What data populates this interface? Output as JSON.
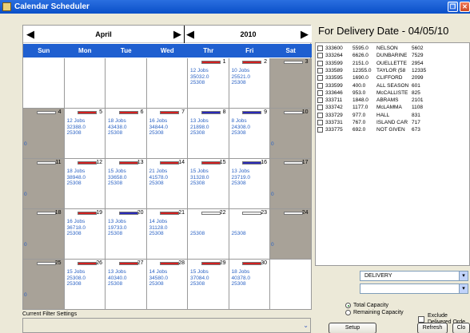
{
  "window": {
    "title": "Calendar Scheduler"
  },
  "calendar": {
    "month": "April",
    "year": "2010",
    "days": [
      "Sun",
      "Mon",
      "Tue",
      "Wed",
      "Thr",
      "Fri",
      "Sat"
    ],
    "weeks": [
      [
        {
          "num": "",
          "gray": false
        },
        {
          "num": "",
          "gray": false
        },
        {
          "num": "",
          "gray": false
        },
        {
          "num": "",
          "gray": false
        },
        {
          "num": "1",
          "gray": false,
          "bar": "red",
          "lines": [
            "12 Jobs",
            "35032.0",
            "25308"
          ]
        },
        {
          "num": "2",
          "gray": false,
          "bar": "red",
          "lines": [
            "10 Jobs",
            "25521.0",
            "25308"
          ]
        },
        {
          "num": "3",
          "gray": true,
          "bar": "white"
        }
      ],
      [
        {
          "num": "4",
          "gray": true,
          "bar": "white",
          "side": "0"
        },
        {
          "num": "5",
          "gray": false,
          "bar": "red",
          "lines": [
            "12 Jobs",
            "32388.0",
            "25308"
          ]
        },
        {
          "num": "6",
          "gray": false,
          "bar": "red",
          "lines": [
            "18 Jobs",
            "43438.0",
            "25308"
          ]
        },
        {
          "num": "7",
          "gray": false,
          "bar": "red",
          "lines": [
            "16 Jobs",
            "34844.0",
            "25308"
          ]
        },
        {
          "num": "8",
          "gray": false,
          "bar": "blue",
          "lines": [
            "13 Jobs",
            "21898.0",
            "25308"
          ]
        },
        {
          "num": "9",
          "gray": false,
          "bar": "blue",
          "lines": [
            "8 Jobs",
            "24308.0",
            "25308"
          ]
        },
        {
          "num": "10",
          "gray": true,
          "bar": "white",
          "side": "0"
        }
      ],
      [
        {
          "num": "11",
          "gray": true,
          "bar": "white",
          "side": "0"
        },
        {
          "num": "12",
          "gray": false,
          "bar": "red",
          "lines": [
            "18 Jobs",
            "38948.0",
            "25308"
          ]
        },
        {
          "num": "13",
          "gray": false,
          "bar": "red",
          "lines": [
            "15 Jobs",
            "33658.0",
            "25308"
          ]
        },
        {
          "num": "14",
          "gray": false,
          "bar": "red",
          "lines": [
            "21 Jobs",
            "41578.0",
            "25308"
          ]
        },
        {
          "num": "15",
          "gray": false,
          "bar": "red",
          "lines": [
            "15 Jobs",
            "31328.0",
            "25308"
          ]
        },
        {
          "num": "16",
          "gray": false,
          "bar": "blue",
          "lines": [
            "13 Jobs",
            "23719.0",
            "25308"
          ]
        },
        {
          "num": "17",
          "gray": true,
          "bar": "white",
          "side": "0"
        }
      ],
      [
        {
          "num": "18",
          "gray": true,
          "bar": "white",
          "side": "0"
        },
        {
          "num": "19",
          "gray": false,
          "bar": "red",
          "lines": [
            "16 Jobs",
            "36718.0",
            "25308"
          ]
        },
        {
          "num": "20",
          "gray": false,
          "bar": "blue",
          "lines": [
            "13 Jobs",
            "19733.0",
            "25308"
          ]
        },
        {
          "num": "21",
          "gray": false,
          "bar": "red",
          "lines": [
            "14 Jobs",
            "31128.0",
            "25308"
          ]
        },
        {
          "num": "22",
          "gray": false,
          "bar": "white",
          "lines": [
            "",
            "",
            "25308"
          ]
        },
        {
          "num": "23",
          "gray": false,
          "bar": "white",
          "lines": [
            "",
            "",
            "25308"
          ]
        },
        {
          "num": "24",
          "gray": true,
          "bar": "white",
          "side": "0"
        }
      ],
      [
        {
          "num": "25",
          "gray": true,
          "bar": "white",
          "side": "0"
        },
        {
          "num": "26",
          "gray": false,
          "bar": "red",
          "lines": [
            "15 Jobs",
            "25308.0",
            "25308"
          ]
        },
        {
          "num": "27",
          "gray": false,
          "bar": "red",
          "lines": [
            "13 Jobs",
            "40340.0",
            "25308"
          ]
        },
        {
          "num": "28",
          "gray": false,
          "bar": "red",
          "lines": [
            "14 Jobs",
            "34580.0",
            "25308"
          ]
        },
        {
          "num": "29",
          "gray": false,
          "bar": "red",
          "lines": [
            "15 Jobs",
            "37084.0",
            "25308"
          ]
        },
        {
          "num": "30",
          "gray": false,
          "bar": "red",
          "lines": [
            "18 Jobs",
            "40378.0",
            "25308"
          ]
        },
        {
          "num": "",
          "gray": false
        }
      ]
    ]
  },
  "filter": {
    "label": "Current Filter Settings"
  },
  "delivery": {
    "title": "For Delivery Date - 04/05/10",
    "rows": [
      [
        "333600",
        "5595.0",
        "NELSON",
        "5602"
      ],
      [
        "333264",
        "6626.0",
        "DUNBARINE",
        "7529"
      ],
      [
        "333599",
        "2151.0",
        "OUELLETTE",
        "2954"
      ],
      [
        "333589",
        "12355.0",
        "TAYLOR (58",
        "12335"
      ],
      [
        "333595",
        "1690.0",
        "CLIFFORD",
        "2099"
      ],
      [
        "333599",
        "400.0",
        "ALL SEASON",
        "601"
      ],
      [
        "333646",
        "953.0",
        "McCALLISTE",
        "825"
      ],
      [
        "333711",
        "1848.0",
        "ABRAMS",
        "2101"
      ],
      [
        "333742",
        "1177.0",
        "McLAMMA",
        "1108"
      ],
      [
        "333729",
        "977.0",
        "HALL",
        "831"
      ],
      [
        "333731",
        "767.0",
        "ISLAND CAR",
        "717"
      ],
      [
        "333775",
        "692.0",
        "NOT GIVEN",
        "673"
      ]
    ],
    "select_value": "DELIVERY",
    "select2_value": ""
  },
  "capacity": {
    "total_label": "Total Capacity",
    "remaining_label": "Remaining Capacity",
    "exclude_label_1": "Exclude",
    "exclude_label_2": "Delivered Orde"
  },
  "buttons": {
    "setup": "Setup Capacities...",
    "refresh": "Refresh",
    "close": "Clo"
  },
  "colors": {
    "header_blue": "#1f5fd0",
    "red_bar": "#d22020",
    "blue_bar": "#2a2ab8",
    "text_blue": "#2a62c4"
  }
}
